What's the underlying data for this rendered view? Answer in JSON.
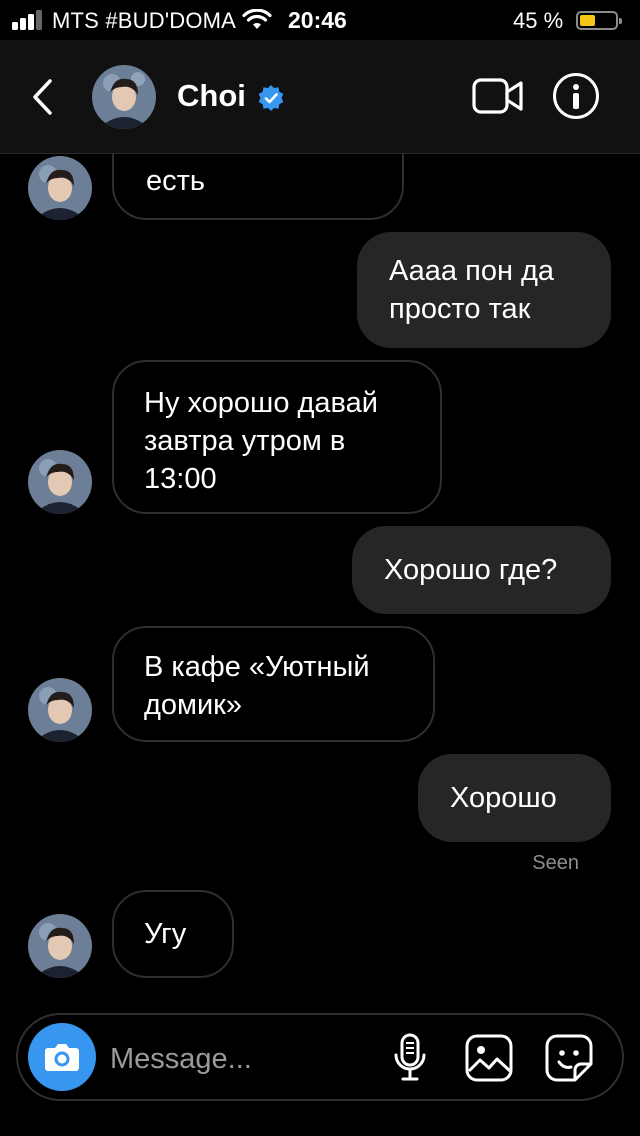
{
  "status_bar": {
    "carrier": "MTS #BUD'DOMA",
    "time": "20:46",
    "battery_percent_label": "45 %",
    "battery_level": 0.45,
    "signal_bars": 3,
    "battery_color": "#f5c518"
  },
  "header": {
    "contact_name": "Choi",
    "verified_badge_color": "#3897f0",
    "icons": [
      "back-chevron-icon",
      "video-call-icon",
      "info-icon"
    ]
  },
  "messages": [
    {
      "direction": "in",
      "text": "есть",
      "partial": true
    },
    {
      "direction": "out",
      "lines": [
        "Аааа пон да",
        "просто так"
      ]
    },
    {
      "direction": "in",
      "lines": [
        "Ну хорошо давай",
        "завтра утром в",
        "13:00"
      ]
    },
    {
      "direction": "out",
      "lines": [
        "Хорошо где?"
      ]
    },
    {
      "direction": "in",
      "lines": [
        "В кафе «Уютный",
        "домик»"
      ]
    },
    {
      "direction": "out",
      "lines": [
        "Хорошо"
      ]
    },
    {
      "direction": "in",
      "lines": [
        "Угу"
      ]
    }
  ],
  "seen_label": "Seen",
  "composer": {
    "placeholder": "Message...",
    "camera_button_color": "#3797f0",
    "icons": [
      "camera-icon",
      "microphone-icon",
      "gallery-icon",
      "sticker-icon"
    ]
  },
  "colors": {
    "background": "#000000",
    "outgoing_bubble": "#262626",
    "incoming_border": "#2f2f2f",
    "header_bg": "#111111"
  }
}
